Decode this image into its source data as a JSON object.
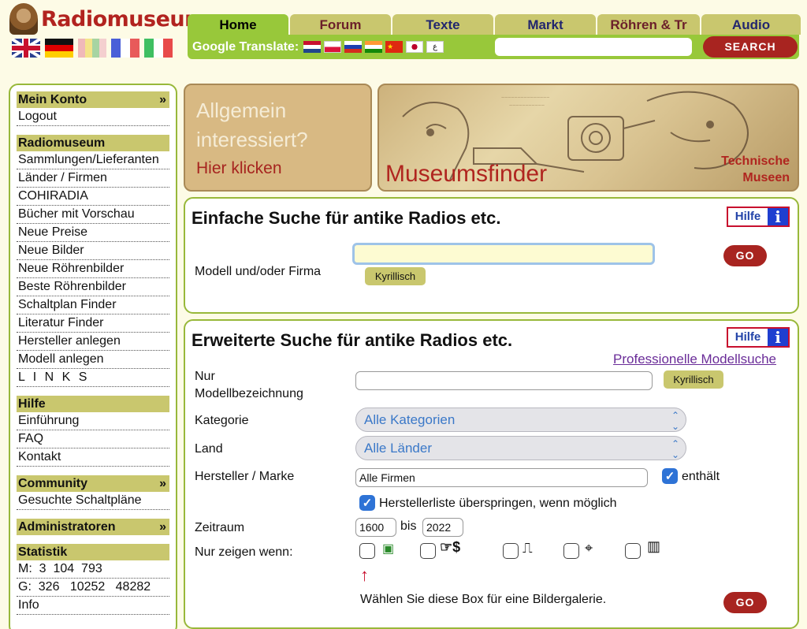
{
  "header": {
    "logo_text": "Radiomuseum",
    "flags": [
      "uk-flag-icon",
      "germany-flag-icon",
      "spain-flag-icon",
      "france-flag-icon",
      "italy-flag-icon"
    ],
    "tabs": [
      {
        "label": "Home"
      },
      {
        "label": "Forum"
      },
      {
        "label": "Texte"
      },
      {
        "label": "Markt"
      },
      {
        "label": "Röhren & Tr"
      },
      {
        "label": "Audio"
      }
    ],
    "translate_label": "Google Translate:",
    "translate_flags": [
      "netherlands-flag-icon",
      "poland-flag-icon",
      "russia-flag-icon",
      "india-flag-icon",
      "china-flag-icon",
      "japan-flag-icon",
      "arabic-flag-icon"
    ],
    "search_value": "",
    "search_button": "SEARCH"
  },
  "sidebar": {
    "sections": [
      {
        "title": "Mein Konto",
        "chevron": "»",
        "items": [
          "Logout"
        ]
      },
      {
        "title": "Radiomuseum",
        "chevron": "",
        "items": [
          "Sammlungen/Lieferanten",
          "Länder / Firmen",
          "COHIRADIA",
          "Bücher mit Vorschau",
          "Neue Preise",
          "Neue Bilder",
          "Neue Röhrenbilder",
          "Beste Röhrenbilder",
          "Schaltplan Finder",
          "Literatur Finder",
          "Hersteller anlegen",
          "Modell anlegen",
          "L I N K S"
        ]
      },
      {
        "title": "Hilfe",
        "chevron": "",
        "items": [
          "Einführung",
          "FAQ",
          "Kontakt"
        ]
      },
      {
        "title": "Community",
        "chevron": "»",
        "items": [
          "Gesuchte Schaltpläne"
        ]
      },
      {
        "title": "Administratoren",
        "chevron": "»",
        "items": []
      },
      {
        "title": "Statistik",
        "chevron": "",
        "items": [
          "M:  3  104  793",
          "G:  326   10252   48282",
          "Info"
        ]
      }
    ]
  },
  "banners": {
    "left_question": "Allgemein interessiert?",
    "left_line1": "Allgemein",
    "left_line2": "interessiert?",
    "left_link": "Hier klicken",
    "right_title": "Museumsfinder",
    "right_sub1": "Technische",
    "right_sub2": "Museen"
  },
  "simple_search": {
    "title": "Einfache Suche für antike Radios etc.",
    "hilfe_label": "Hilfe",
    "hilfe_icon": "i",
    "field_label": "Modell und/oder Firma",
    "field_value": "",
    "kyrillisch": "Kyrillisch",
    "go": "GO"
  },
  "extended_search": {
    "title": "Erweiterte Suche für antike Radios etc.",
    "hilfe_label": "Hilfe",
    "hilfe_icon": "i",
    "pro_link": "Professionelle Modellsuche",
    "model_label_1": "Nur",
    "model_label_2": "Modellbezeichnung",
    "model_value": "",
    "kyrillisch": "Kyrillisch",
    "kategorie_label": "Kategorie",
    "kategorie_value": "Alle Kategorien",
    "land_label": "Land",
    "land_value": "Alle Länder",
    "hersteller_label": "Hersteller / Marke",
    "hersteller_value": "Alle Firmen",
    "enthaelt_label": "enthält",
    "enthaelt_checked": true,
    "skip_label": "Herstellerliste überspringen, wenn möglich",
    "skip_checked": true,
    "zeitraum_label": "Zeitraum",
    "zeitraum_from": "1600",
    "bis_label": "bis",
    "zeitraum_to": "2022",
    "nur_zeigen_label": "Nur zeigen wenn:",
    "filter_icons": [
      "photo-icon",
      "price-hand-icon",
      "schematic-icon",
      "tube-icon",
      "keyboard-icon"
    ],
    "filter_glyphs": [
      "▣",
      "☞$",
      "⎍",
      "⌖",
      "▥"
    ],
    "hint": "Wählen Sie diese Box für eine Bildergalerie.",
    "go": "GO"
  }
}
